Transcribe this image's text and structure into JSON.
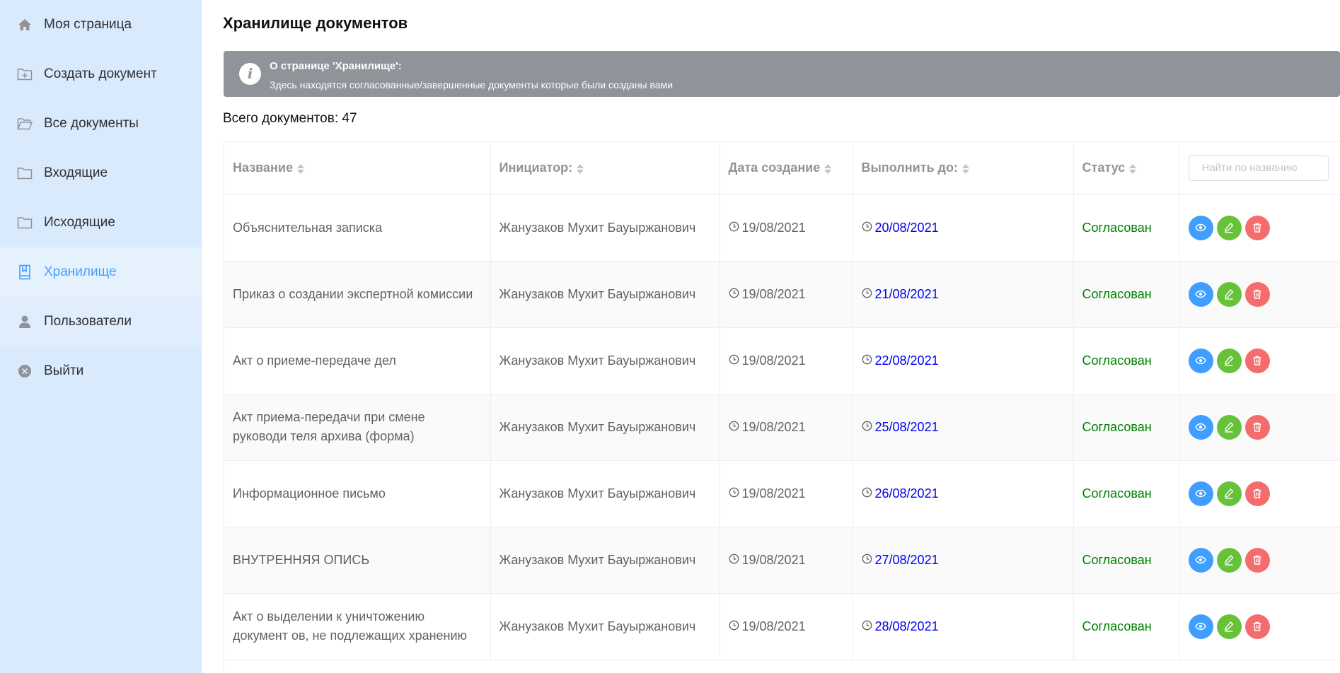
{
  "sidebar": {
    "items": [
      {
        "label": "Моя страница",
        "icon": "home-icon"
      },
      {
        "label": "Создать документ",
        "icon": "folder-add-icon"
      },
      {
        "label": "Все документы",
        "icon": "folder-opened-icon"
      },
      {
        "label": "Входящие",
        "icon": "folder-icon"
      },
      {
        "label": "Исходящие",
        "icon": "folder-icon"
      },
      {
        "label": "Хранилище",
        "icon": "notebook-icon"
      },
      {
        "label": "Пользователи",
        "icon": "user-icon"
      },
      {
        "label": "Выйти",
        "icon": "circle-close-icon"
      }
    ],
    "active_index": 5
  },
  "main": {
    "title": "Хранилище документов",
    "info": {
      "title": "О странице 'Хранилище':",
      "description": "Здесь находятся согласованные/завершенные документы которые были созданы вами",
      "icon": "info-icon"
    },
    "total_label": "Всего документов: 47"
  },
  "table": {
    "columns": {
      "name": "Название",
      "initiator": "Инициатор:",
      "created": "Дата создание",
      "due": "Выполнить до:",
      "status": "Статус"
    },
    "search_placeholder": "Найти по названию",
    "rows": [
      {
        "name": "Объяснительная записка",
        "initiator": "Жанузаков Мухит Бауыржанович",
        "created": "19/08/2021",
        "due": "20/08/2021",
        "status": "Согласован"
      },
      {
        "name": "Приказ о создании экспертной комиссии",
        "initiator": "Жанузаков Мухит Бауыржанович",
        "created": "19/08/2021",
        "due": "21/08/2021",
        "status": "Согласован"
      },
      {
        "name": "Акт о приеме-передаче дел",
        "initiator": "Жанузаков Мухит Бауыржанович",
        "created": "19/08/2021",
        "due": "22/08/2021",
        "status": "Согласован"
      },
      {
        "name": "Акт приема-передачи при смене руководи теля архива (форма)",
        "initiator": "Жанузаков Мухит Бауыржанович",
        "created": "19/08/2021",
        "due": "25/08/2021",
        "status": "Согласован"
      },
      {
        "name": "Информационное письмо",
        "initiator": "Жанузаков Мухит Бауыржанович",
        "created": "19/08/2021",
        "due": "26/08/2021",
        "status": "Согласован"
      },
      {
        "name": "ВНУТРЕННЯЯ ОПИСЬ",
        "initiator": "Жанузаков Мухит Бауыржанович",
        "created": "19/08/2021",
        "due": "27/08/2021",
        "status": "Согласован"
      },
      {
        "name": "Акт о выделении к уничтожению документ ов, не подлежащих хранению",
        "initiator": "Жанузаков Мухит Бауыржанович",
        "created": "19/08/2021",
        "due": "28/08/2021",
        "status": "Согласован"
      }
    ],
    "actions": [
      "view-icon",
      "edit-icon",
      "delete-icon"
    ]
  },
  "colors": {
    "sidebar_bg": "#daeafd",
    "accent": "#409eff",
    "status_green": "#008000",
    "due_blue": "#0000ee",
    "info_bg": "#909399",
    "btn_view": "#409eff",
    "btn_edit": "#67c23a",
    "btn_delete": "#f56c6c"
  }
}
